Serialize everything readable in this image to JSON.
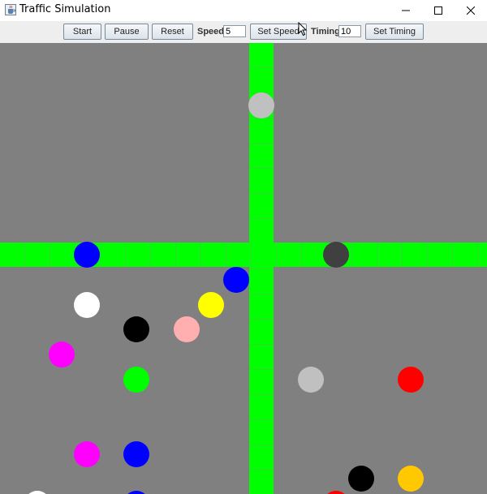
{
  "window": {
    "title": "Traffic Simulation",
    "icon": "java-cup-icon",
    "controls": [
      "minimize-icon",
      "maximize-icon",
      "close-icon"
    ]
  },
  "toolbar": {
    "start_label": "Start",
    "pause_label": "Pause",
    "reset_label": "Reset",
    "speed_label": "Speed:",
    "speed_value": "5",
    "set_speed_label": "Set Speed",
    "timing_label": "Timing:",
    "timing_value": "10",
    "set_timing_label": "Set Timing"
  },
  "simulation": {
    "background_color": "#808080",
    "road_color": "#00ff00",
    "car_colors": [
      "#c0c0c0",
      "#0000ff",
      "#404040",
      "#ffff00",
      "#ffffff",
      "#000000",
      "#ffafaf",
      "#ff00ff",
      "#00ff00",
      "#ff0000",
      "#ffc800"
    ]
  }
}
